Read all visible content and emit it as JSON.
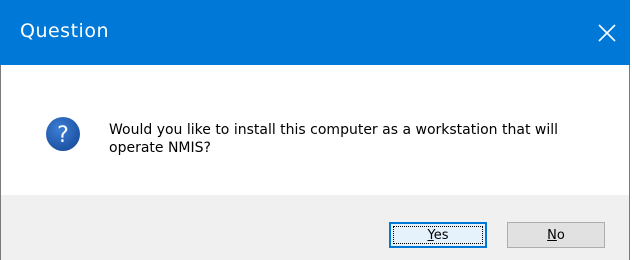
{
  "window": {
    "title": "Question",
    "close_icon": "close-icon"
  },
  "message": {
    "icon": "question-icon",
    "text": "Would you like to install this computer as a workstation that will operate NMIS?"
  },
  "buttons": {
    "yes": {
      "mnemonic": "Y",
      "rest": "es"
    },
    "no": {
      "mnemonic": "N",
      "rest": "o"
    }
  },
  "colors": {
    "titlebar": "#0078d7",
    "icon": "#1e5cb3",
    "footer": "#f0f0f0"
  }
}
